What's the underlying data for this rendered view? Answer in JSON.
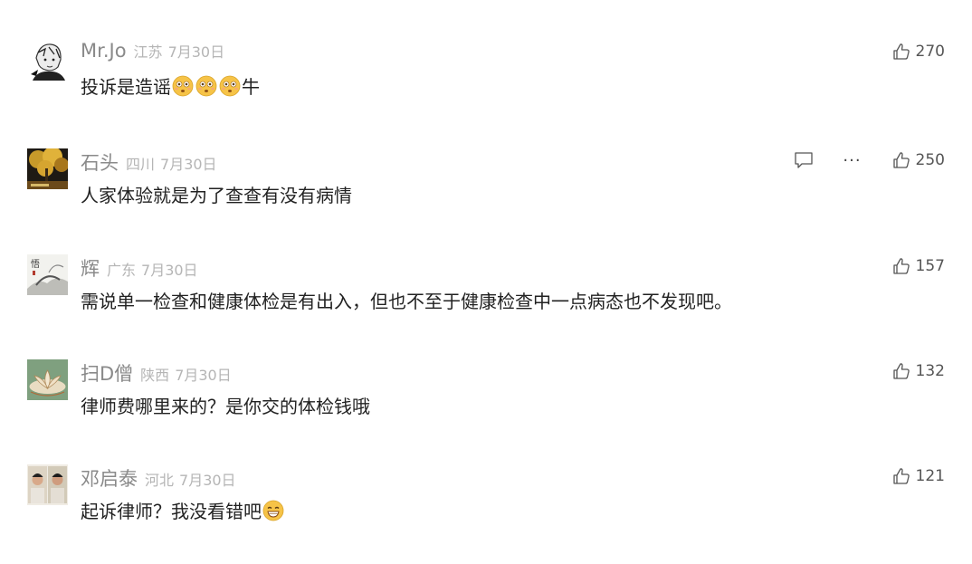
{
  "comments": [
    {
      "username": "Mr.Jo",
      "region": "江苏",
      "date": "7月30日",
      "text": "投诉是造谣",
      "emoji_suffix": [
        "flushed-emoji",
        "flushed-emoji",
        "flushed-emoji"
      ],
      "text_after": "牛",
      "likes": "270",
      "avatar": "anime-boy-sketch-avatar"
    },
    {
      "username": "石头",
      "region": "四川",
      "date": "7月30日",
      "text": "人家体验就是为了查查有没有病情",
      "likes": "250",
      "avatar": "autumn-tree-avatar",
      "show_reply_actions": true
    },
    {
      "username": "辉",
      "region": "广东",
      "date": "7月30日",
      "text": "需说单一检查和健康体检是有出入，但也不至于健康检查中一点病态也不发现吧。",
      "likes": "157",
      "avatar": "ink-painting-avatar"
    },
    {
      "username": "扫D僧",
      "region": "陕西",
      "date": "7月30日",
      "text": "律师费哪里来的？是你交的体检钱哦",
      "likes": "132",
      "avatar": "lotus-avatar"
    },
    {
      "username": "邓启泰",
      "region": "河北",
      "date": "7月30日",
      "text": "起诉律师？我没看错吧",
      "emoji_end": "grinning-emoji",
      "likes": "121",
      "avatar": "two-photos-avatar"
    }
  ],
  "icons": {
    "like": "thumbs-up-outline-icon",
    "reply": "speech-bubble-icon",
    "more": "ellipsis-icon"
  },
  "colors": {
    "username": "#8a8a8a",
    "meta": "#b5b5b5",
    "text": "#222222",
    "like_count": "#555555",
    "emoji_face": "#f6c347"
  }
}
